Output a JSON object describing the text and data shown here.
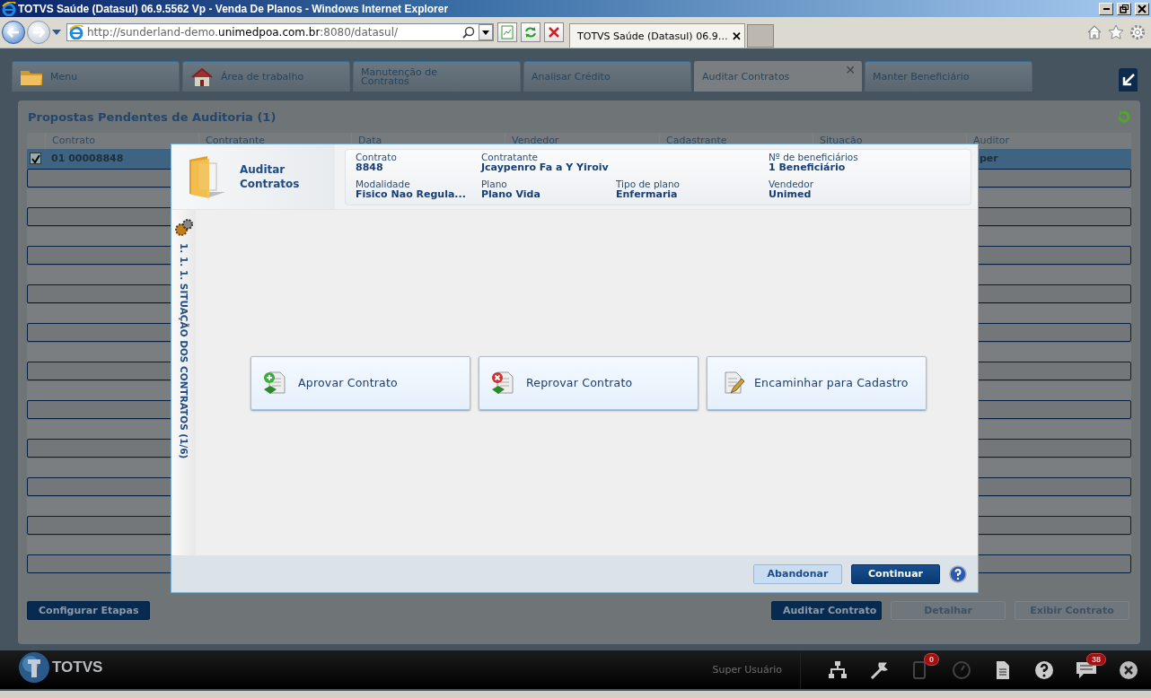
{
  "window": {
    "title": "TOTVS Saúde (Datasul) 06.9.5562 Vp - Venda De Planos - Windows Internet Explorer"
  },
  "browser": {
    "url": {
      "scheme": "http://sunderland-demo.",
      "host": "unimedpoa.com.br",
      "rest": ":8080/datasul/"
    },
    "tab_title": "TOTVS Saúde (Datasul) 06.9…",
    "tab_close": "✕"
  },
  "app_tabs": [
    {
      "label": "Menu",
      "selected": false
    },
    {
      "label": "Área de trabalho",
      "selected": false
    },
    {
      "label": "Manutenção de Contratos",
      "selected": false
    },
    {
      "label": "Analisar Crédito",
      "selected": false
    },
    {
      "label": "Auditar Contratos",
      "selected": true,
      "close": "✕"
    },
    {
      "label": "Manter Beneficiário",
      "selected": false
    }
  ],
  "panel": {
    "title": "Propostas Pendentes de Auditoria (1)",
    "table": {
      "columns": [
        "Contrato",
        "Contratante",
        "Data",
        "Vendedor",
        "Cadastrante",
        "Situação",
        "Auditor"
      ],
      "rows": [
        {
          "checked": true,
          "selected": true,
          "cells": [
            "01 00008848",
            "",
            "",
            "",
            "",
            "",
            "per"
          ]
        }
      ]
    },
    "left_buttons": [
      {
        "label": "Configurar Etapas",
        "disabled": false
      }
    ],
    "right_buttons": [
      {
        "label": "Auditar Contrato",
        "disabled": false
      },
      {
        "label": "Detalhar",
        "disabled": true
      },
      {
        "label": "Exibir Contrato",
        "disabled": true
      }
    ]
  },
  "dialog": {
    "title": "Auditar Contratos",
    "info": [
      {
        "label": "Contrato",
        "value": "8848"
      },
      {
        "label": "Contratante",
        "value": "Jcaypenro Fa a  Y  Yiroiv"
      },
      {
        "label": "Nº de beneficiários",
        "value": "1 Beneficiário"
      },
      {
        "label": "Modalidade",
        "value": "Fisico Nao Regula..."
      },
      {
        "label": "Plano",
        "value": "Plano Vida"
      },
      {
        "label": "Tipo de plano",
        "value": "Enfermaria"
      },
      {
        "label": "Vendedor",
        "value": "Unimed"
      }
    ],
    "step": "1. 1. 1. SITUAÇÃO DOS CONTRATOS (1/6)",
    "actions": [
      {
        "label": "Aprovar Contrato",
        "kind": "approve"
      },
      {
        "label": "Reprovar Contrato",
        "kind": "reject"
      },
      {
        "label": "Encaminhar para Cadastro",
        "kind": "forward"
      }
    ],
    "buttons": [
      {
        "label": "Abandonar",
        "kind": "secondary"
      },
      {
        "label": "Continuar",
        "kind": "primary"
      }
    ]
  },
  "footer": {
    "brand": "TOTVS",
    "user": "Super Usuário",
    "icons": [
      {
        "kind": "hierarchy"
      },
      {
        "kind": "wrench"
      },
      {
        "kind": "device",
        "badge": "0"
      },
      {
        "kind": "clock"
      },
      {
        "kind": "document"
      },
      {
        "kind": "help"
      },
      {
        "kind": "chat",
        "badge": "38"
      },
      {
        "kind": "close"
      }
    ]
  }
}
